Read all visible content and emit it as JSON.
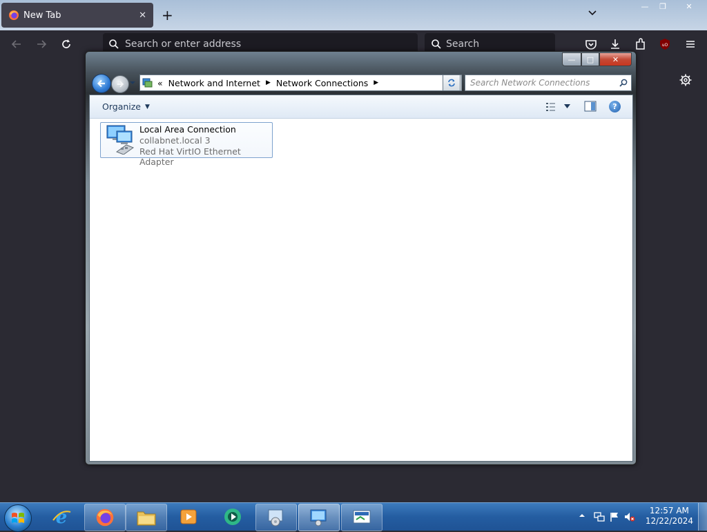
{
  "browser": {
    "tab": {
      "title": "New Tab",
      "close_glyph": "✕"
    },
    "new_tab_glyph": "+",
    "url_placeholder": "Search or enter address",
    "search_placeholder": "Search",
    "window_controls": {
      "minimize": "—",
      "restore": "❐",
      "close": "✕"
    },
    "toolbar_icons": [
      "pocket-icon",
      "download-icon",
      "extensions-icon",
      "ublock-icon",
      "menu-icon"
    ],
    "accent": "#2b2a33"
  },
  "explorer": {
    "caption_buttons": {
      "minimize": "—",
      "maximize": "□",
      "close": "✕"
    },
    "breadcrumb": {
      "overflow": "«",
      "items": [
        "Network and Internet",
        "Network Connections"
      ],
      "separator": "▶"
    },
    "search_placeholder": "Search Network Connections",
    "command_bar": {
      "organize": "Organize",
      "help": "?"
    },
    "connection": {
      "name": "Local Area Connection",
      "network": "collabnet.local  3",
      "adapter": "Red Hat VirtIO Ethernet Adapter"
    }
  },
  "taskbar": {
    "items": [
      {
        "icon": "internet-explorer-icon"
      },
      {
        "icon": "firefox-icon"
      },
      {
        "icon": "file-explorer-icon"
      },
      {
        "icon": "media-player-icon"
      },
      {
        "icon": "chat-app-icon"
      },
      {
        "icon": "control-panel-icon"
      },
      {
        "icon": "network-connections-icon"
      },
      {
        "icon": "remote-desktop-icon"
      }
    ],
    "clock": {
      "time": "12:57 AM",
      "date": "12/22/2024"
    },
    "tray_icons": [
      "show-hidden-icons-icon",
      "network-icon",
      "action-center-flag-icon",
      "volume-muted-icon"
    ]
  }
}
